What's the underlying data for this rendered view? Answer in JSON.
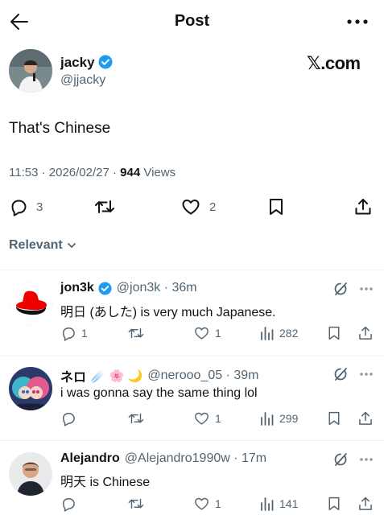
{
  "header": {
    "title": "Post"
  },
  "post": {
    "author_name": "jacky",
    "author_handle": "@jjacky",
    "brand": "𝕏.com",
    "text": "That's Chinese",
    "timestamp": "11:53 · 2026/02/27 · ",
    "views_count": "944",
    "views_label": " Views",
    "reply_count": "3",
    "like_count": "2"
  },
  "sort": {
    "label": "Relevant"
  },
  "replies": [
    {
      "name": "jon3k",
      "handle": "@jon3k · 36m",
      "text": "明日 (あした) is very much Japanese.",
      "replies": "1",
      "likes": "1",
      "views": "282",
      "verified": true
    },
    {
      "name": "ネロ",
      "emojis": "☄️ 🌸 🌙",
      "handle": "@nerooo_05 · 39m",
      "text": "i was gonna say the same thing lol",
      "replies": "",
      "likes": "1",
      "views": "299"
    },
    {
      "name": "Alejandro",
      "handle": "@Alejandro1990w · 17m",
      "text": "明天 is Chinese",
      "replies": "",
      "likes": "1",
      "views": "141"
    }
  ],
  "colors": {
    "verified": "#1d9bf0",
    "text": "#0f1419",
    "secondary": "#536471",
    "divider": "#eff3f4"
  }
}
